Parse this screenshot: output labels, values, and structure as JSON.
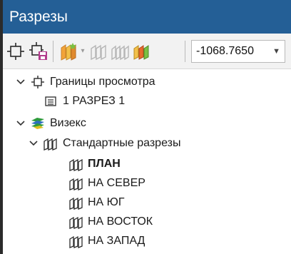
{
  "window": {
    "title": "Разрезы"
  },
  "toolbar": {
    "icons": [
      "view-bounds-icon",
      "view-bounds-save-icon",
      "new-section-icon",
      "section-gray-icon",
      "section-gray-2-icon",
      "section-color-icon"
    ],
    "elevation_value": "-1068.7650"
  },
  "tree": {
    "bounds_group": {
      "label": "Границы просмотра",
      "item": "1 РАЗРЕЗ 1"
    },
    "project": {
      "label": "Визекс"
    },
    "standard_sections": {
      "label": "Стандартные разрезы",
      "items": [
        "ПЛАН",
        "НА СЕВЕР",
        "НА ЮГ",
        "НА ВОСТОК",
        "НА ЗАПАД"
      ]
    }
  },
  "colors": {
    "titlebar": "#245f96",
    "toolbar": "#f2f2f2",
    "section_icon": "#2b2b2b",
    "project_icon_green": "#2e9b3c",
    "project_icon_blue": "#2e6fbe",
    "new_section_orange": "#f2a43a"
  }
}
